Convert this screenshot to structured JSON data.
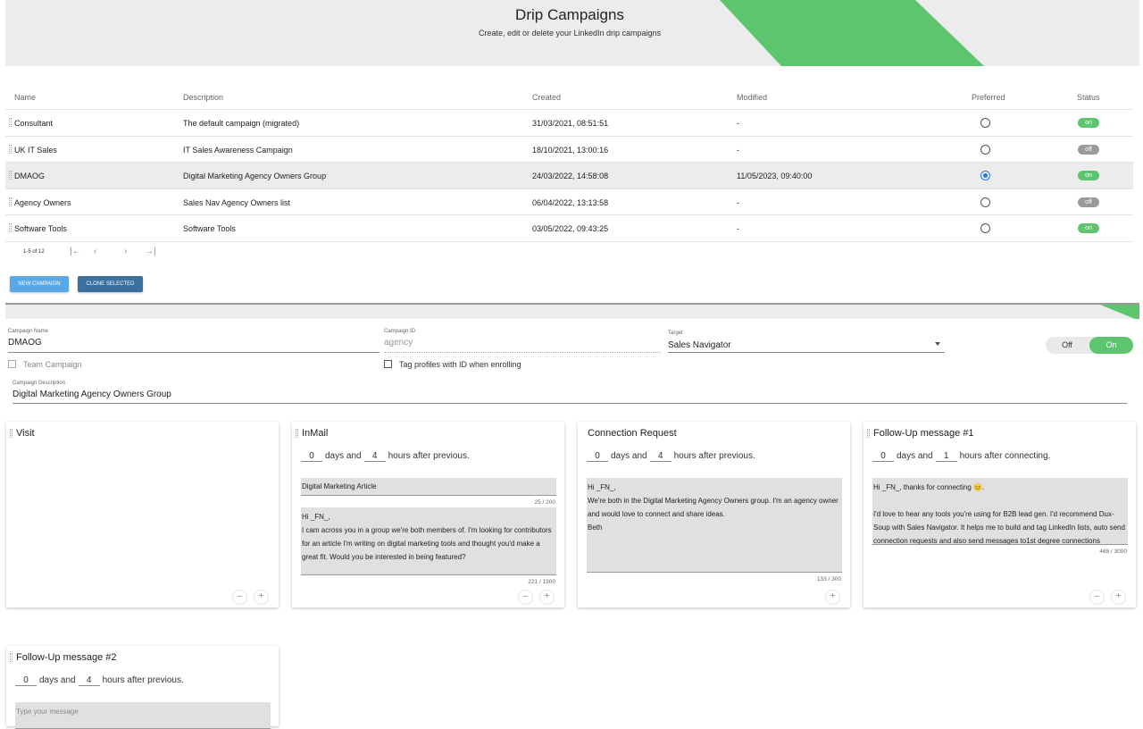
{
  "header": {
    "title": "Drip Campaigns",
    "subtitle": "Create, edit or delete your LinkedIn drip campaigns",
    "accent_color": "#5cc56e"
  },
  "table": {
    "columns": [
      "Name",
      "Description",
      "Created",
      "Modified",
      "Preferred",
      "Status"
    ],
    "rows": [
      {
        "name": "Consultant",
        "description": "The default campaign (migrated)",
        "created": "31/03/2021, 08:51:51",
        "modified": "-",
        "preferred": false,
        "status": "on"
      },
      {
        "name": "UK IT Sales",
        "description": "IT Sales Awareness Campaign",
        "created": "18/10/2021, 13:00:16",
        "modified": "-",
        "preferred": false,
        "status": "off"
      },
      {
        "name": "DMAOG",
        "description": "Digital Marketing Agency Owners Group",
        "created": "24/03/2022, 14:58:08",
        "modified": "11/05/2023, 09:40:00",
        "preferred": true,
        "status": "on"
      },
      {
        "name": "Agency Owners",
        "description": "Sales Nav Agency Owners list",
        "created": "06/04/2022, 13:13:58",
        "modified": "-",
        "preferred": false,
        "status": "off"
      },
      {
        "name": "Software Tools",
        "description": "Software Tools",
        "created": "03/05/2022, 09:43:25",
        "modified": "-",
        "preferred": false,
        "status": "on"
      }
    ],
    "pagination": "1-5 of 12"
  },
  "actions": {
    "new_campaign": "NEW CAMPAIGN",
    "clone_selected": "CLONE SELECTED"
  },
  "campaign": {
    "name_label": "Campaign Name",
    "name_value": "DMAOG",
    "id_label": "Campaign ID",
    "id_placeholder": "agency",
    "target_label": "Target",
    "target_value": "Sales Navigator",
    "toggle_off": "Off",
    "toggle_on": "On",
    "team_campaign_label": "Team Campaign",
    "tag_profiles_label": "Tag profiles with ID when enrolling",
    "description_label": "Campaign Description",
    "description_value": "Digital Marketing Agency Owners Group"
  },
  "timing_words": {
    "days_and": "days and",
    "hours_after_previous": "hours after previous.",
    "hours_after_connecting": "hours after connecting."
  },
  "steps": {
    "visit": {
      "title": "Visit"
    },
    "inmail": {
      "title": "InMail",
      "days": "0",
      "hours": "4",
      "subject": "Digital Marketing Article",
      "subject_counter": "25 / 200",
      "message": "Hi _FN_,\nI cam across you in a group we're both members of. I'm looking for contributors for an article I'm writing on digital marketing tools and thought you'd make a great fit. Would you be interested in being featured?",
      "message_counter": "221 / 1900"
    },
    "connection": {
      "title": "Connection Request",
      "days": "0",
      "hours": "4",
      "message": "Hi _FN_,\nWe're both in the Digital Marketing Agency Owners group. I'm an agency owner and would love to connect and share ideas.\nBeth",
      "message_counter": "133 / 300"
    },
    "followup1": {
      "title": "Follow-Up message #1",
      "days": "0",
      "hours": "1",
      "message": "Hi _FN_, thanks for connecting 😊.\n\nI'd love to hear any tools you're using for B2B lead gen. I'd recommend Dux-Soup with Sales Navigator. It helps me to build and tag LinkedIn lists, auto send connection requests and also send messages to1st degree connections",
      "message_counter": "468 / 3000"
    },
    "followup2": {
      "title": "Follow-Up message #2",
      "days": "0",
      "hours": "4",
      "placeholder": "Type your message"
    }
  }
}
